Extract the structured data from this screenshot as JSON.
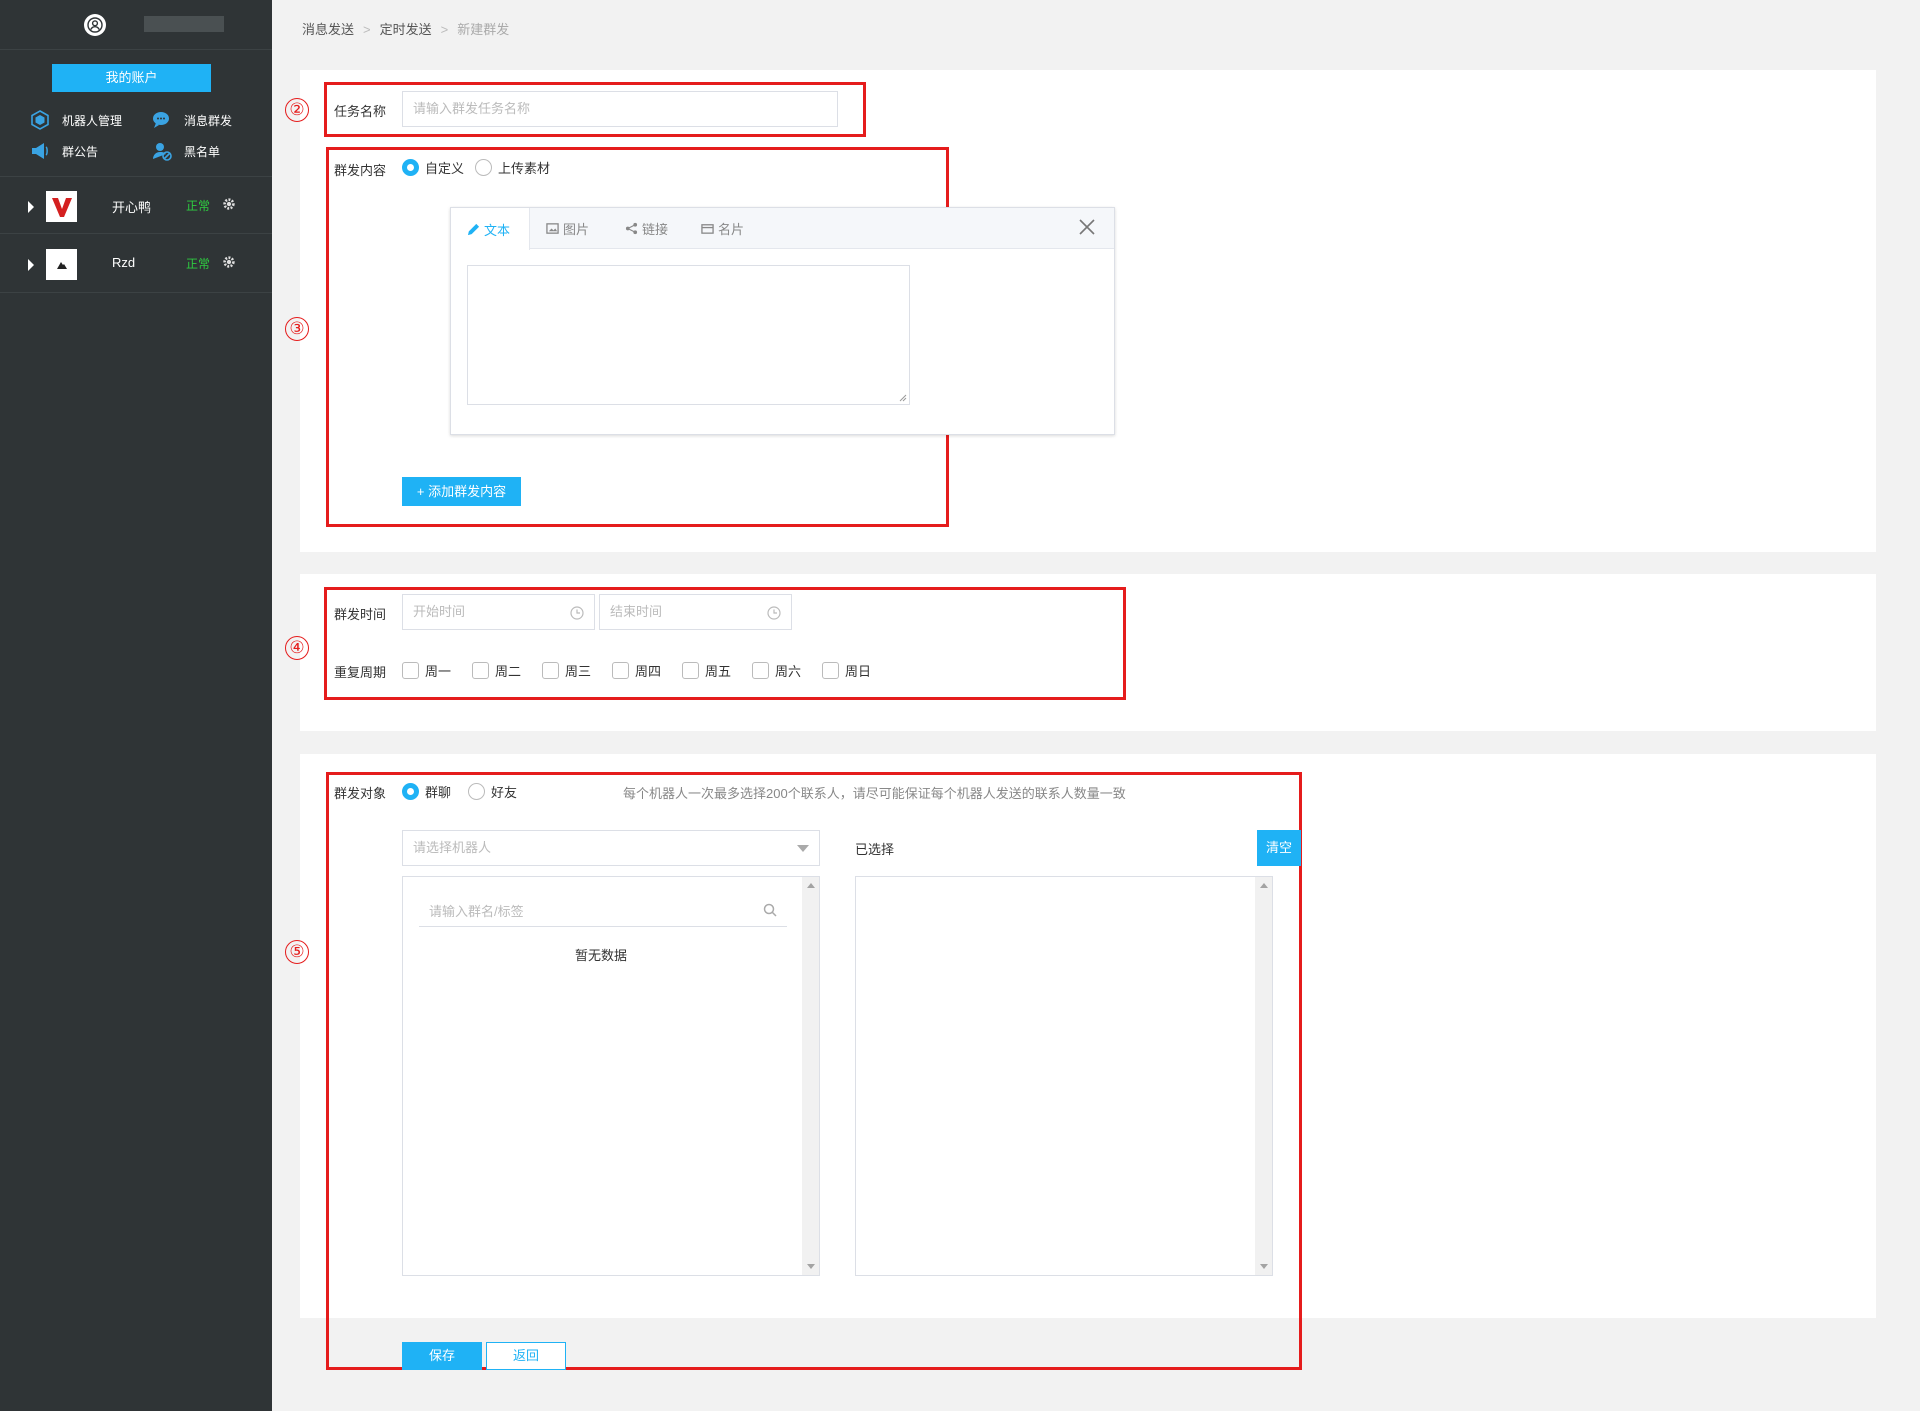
{
  "sidebar": {
    "account_button": "我的账户",
    "nav": [
      {
        "label": "机器人管理",
        "icon": "robot-icon"
      },
      {
        "label": "消息群发",
        "icon": "chat-bubble-icon"
      },
      {
        "label": "群公告",
        "icon": "megaphone-icon"
      },
      {
        "label": "黑名单",
        "icon": "blocked-user-icon"
      }
    ],
    "robots": [
      {
        "name": "开心鸭",
        "status": "正常"
      },
      {
        "name": "Rzd",
        "status": "正常"
      }
    ]
  },
  "breadcrumb": {
    "items": [
      "消息发送",
      "定时发送",
      "新建群发"
    ],
    "separator": ">"
  },
  "annotations": [
    "②",
    "③",
    "④",
    "⑤"
  ],
  "task": {
    "label": "任务名称",
    "placeholder": "请输入群发任务名称"
  },
  "content": {
    "label": "群发内容",
    "options": [
      "自定义",
      "上传素材"
    ],
    "selected": "自定义",
    "tabs": [
      "文本",
      "图片",
      "链接",
      "名片"
    ],
    "active_tab": "文本",
    "add_button": "+ 添加群发内容"
  },
  "schedule": {
    "time_label": "群发时间",
    "start_placeholder": "开始时间",
    "end_placeholder": "结束时间",
    "repeat_label": "重复周期",
    "days": [
      "周一",
      "周二",
      "周三",
      "周四",
      "周五",
      "周六",
      "周日"
    ]
  },
  "target": {
    "label": "群发对象",
    "options": [
      "群聊",
      "好友"
    ],
    "selected": "群聊",
    "hint": "每个机器人一次最多选择200个联系人，请尽可能保证每个机器人发送的联系人数量一致",
    "robot_select_placeholder": "请选择机器人",
    "search_placeholder": "请输入群名/标签",
    "empty_text": "暂无数据",
    "selected_label": "已选择",
    "clear_button": "清空"
  },
  "actions": {
    "save": "保存",
    "back": "返回"
  },
  "colors": {
    "accent": "#1fb2f5",
    "sidebar_bg": "#2f3436",
    "annotation": "#e51c1c",
    "status_ok": "#2ecc40"
  }
}
